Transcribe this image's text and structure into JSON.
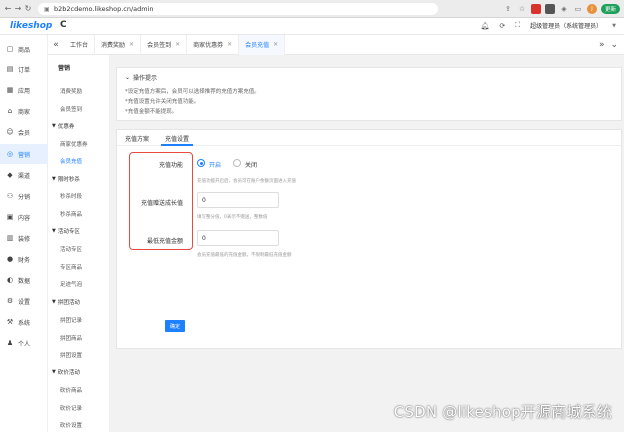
{
  "browser": {
    "url": "b2b2cdemo.likeshop.cn/admin",
    "ext_badge_1": "☐",
    "ext_badge_2": "☐",
    "profile_initial": "J",
    "update_label": "更新"
  },
  "header": {
    "logo": "likeshop",
    "admin_name": "超级管理员（系统管理员）"
  },
  "rail": {
    "items": [
      {
        "label": "商品",
        "icon": "goods-icon"
      },
      {
        "label": "订单",
        "icon": "order-icon"
      },
      {
        "label": "应用",
        "icon": "app-icon"
      },
      {
        "label": "商家",
        "icon": "shop-icon"
      },
      {
        "label": "会员",
        "icon": "user-icon"
      },
      {
        "label": "营销",
        "icon": "marketing-icon"
      },
      {
        "label": "渠道",
        "icon": "channel-icon"
      },
      {
        "label": "分销",
        "icon": "distribution-icon"
      },
      {
        "label": "内容",
        "icon": "content-icon"
      },
      {
        "label": "装修",
        "icon": "decoration-icon"
      },
      {
        "label": "财务",
        "icon": "finance-icon"
      },
      {
        "label": "数据",
        "icon": "data-icon"
      },
      {
        "label": "设置",
        "icon": "settings-icon"
      },
      {
        "label": "系统",
        "icon": "system-icon"
      },
      {
        "label": "个人",
        "icon": "person-icon"
      }
    ]
  },
  "submenu": {
    "title": "营销",
    "items": {
      "consume_reward": "消费奖励",
      "member_signin": "会员签到",
      "coupon_group": "优惠券",
      "shop_coupon": "商家优惠券",
      "member_recharge": "会员充值",
      "flash_group": "限时秒杀",
      "flash_time": "秒杀时段",
      "flash_goods": "秒杀商品",
      "activity_group": "活动专区",
      "activity_zone": "活动专区",
      "zone_goods": "专区商品",
      "bubble": "足迹气泡",
      "team_group": "拼团活动",
      "team_record": "拼团记录",
      "team_goods": "拼团商品",
      "team_settings": "拼团设置",
      "bargain_group": "砍价活动",
      "bargain_goods": "砍价商品",
      "bargain_record": "砍价记录",
      "bargain_settings": "砍价设置"
    }
  },
  "tabs": {
    "items": [
      "工作台",
      "消费奖励",
      "会员签到",
      "商家优惠券",
      "会员充值"
    ]
  },
  "notice": {
    "title": "操作提示",
    "lines": [
      "*设定充值方案后，会员可以选择推荐的充值方案充值。",
      "*充值设置允许关闭充值功能。",
      "*充值金额不能提现。"
    ]
  },
  "main": {
    "tab_plan": "充值方案",
    "tab_settings": "充值设置",
    "labels": {
      "recharge_func": "充值功能",
      "growth": "充值赠送成长值",
      "min_amount": "最低充值金额"
    },
    "radio_on": "开启",
    "radio_off": "关闭",
    "hint_func": "充值功能开启后，会员可在账户余额页面进入充值",
    "hint_growth": "填写整分值，0表示不赠送，整数值",
    "hint_min": "会员充值最低的充值金额，不限制最低充值金额",
    "growth_value": "0",
    "min_value": "0",
    "confirm": "确定"
  },
  "watermark": "CSDN @likeshop开源商城系统",
  "colors": {
    "accent": "#1e80ff",
    "highlight": "#e74c3c"
  }
}
